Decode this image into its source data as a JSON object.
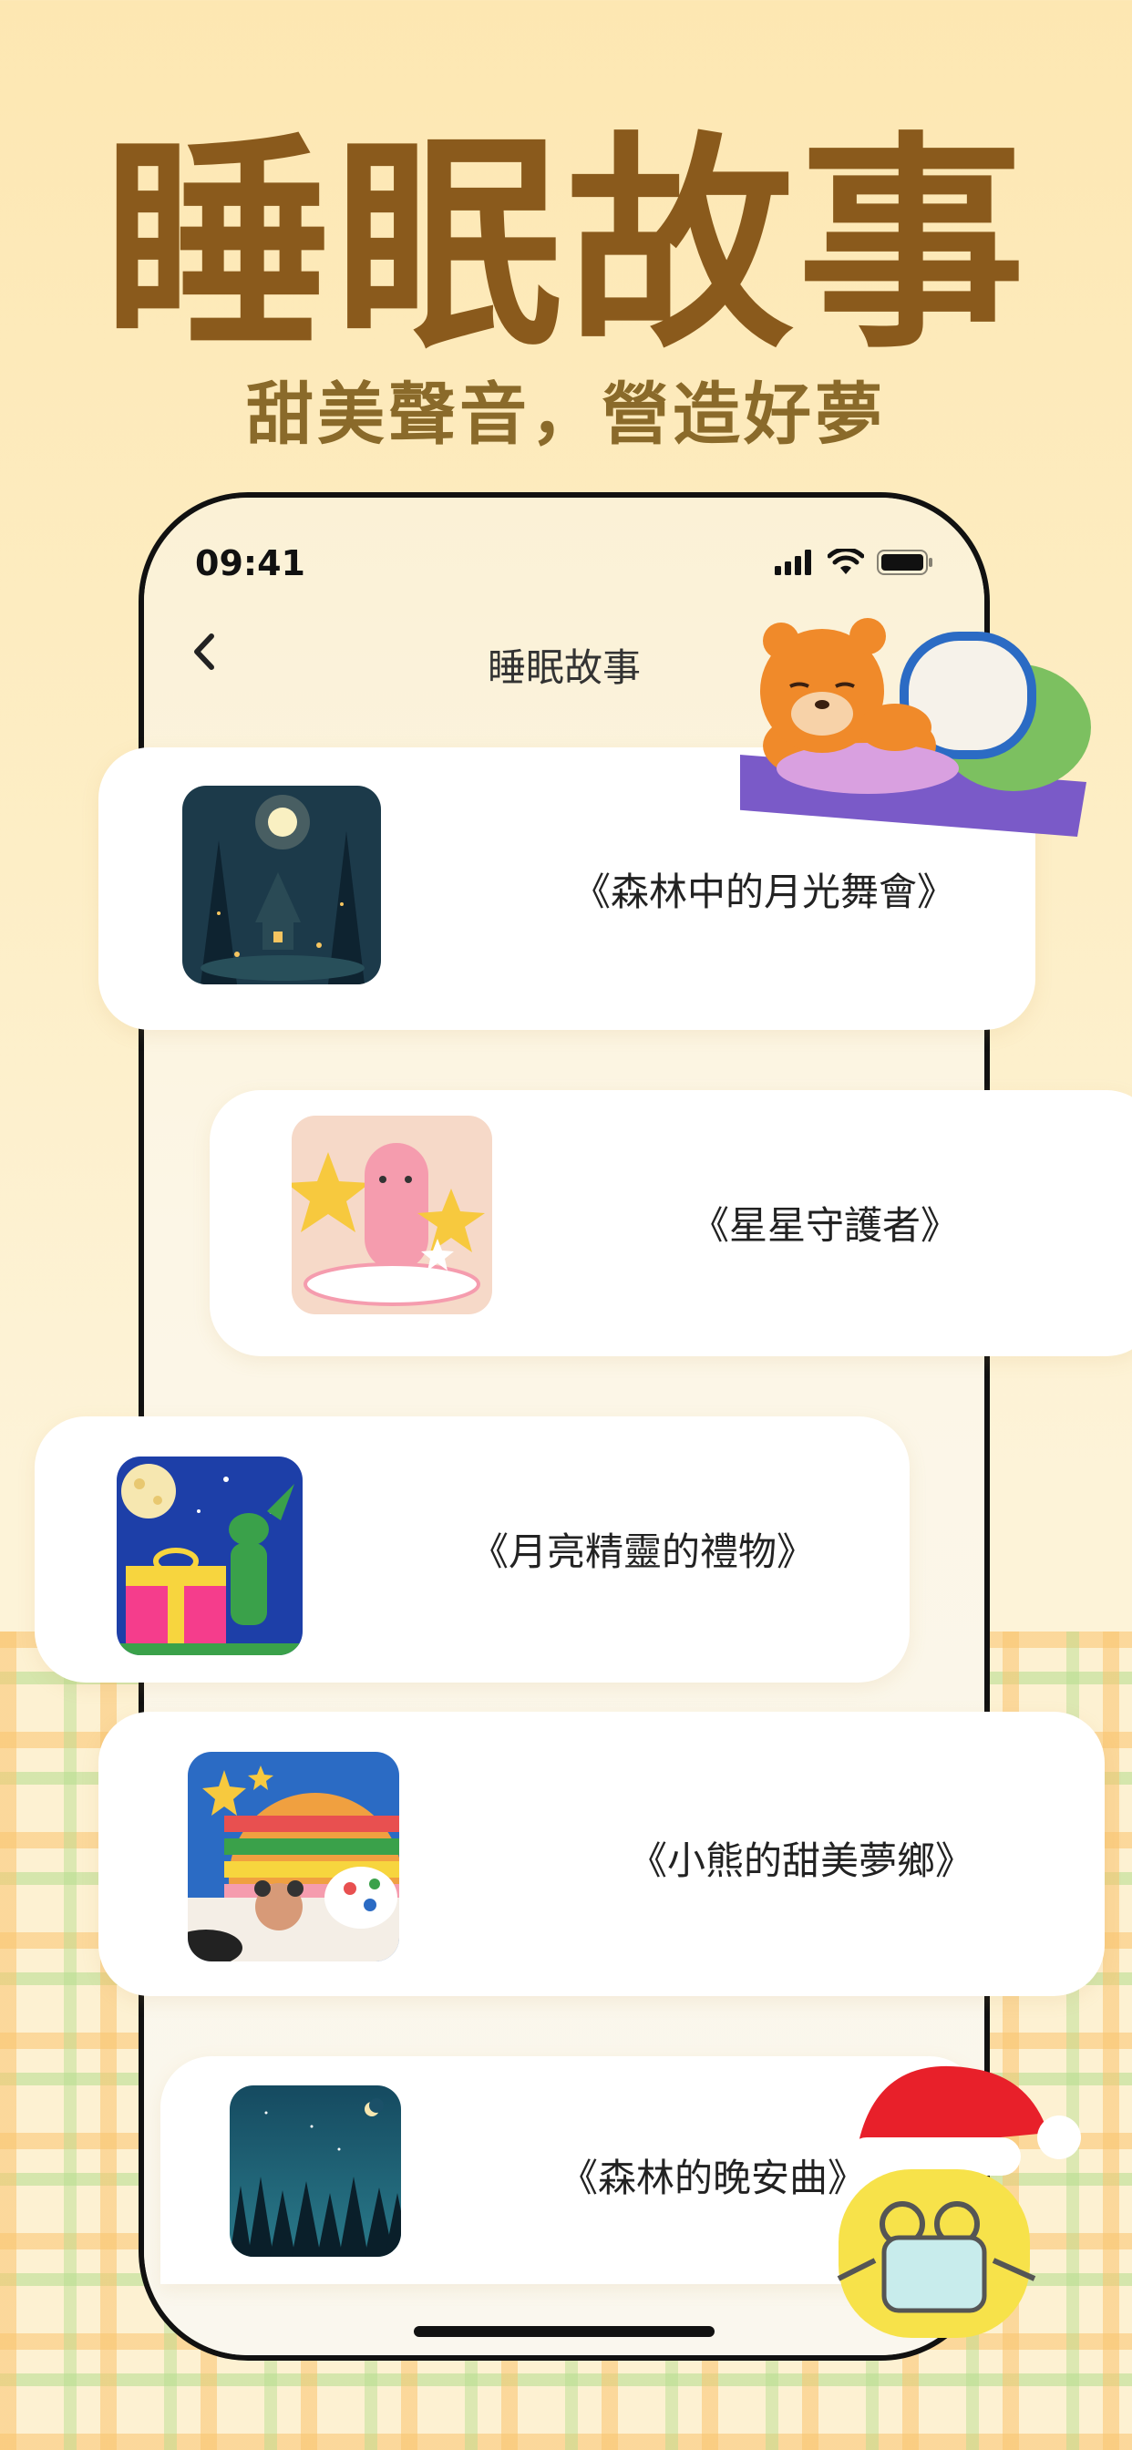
{
  "hero": {
    "title": "睡眠故事",
    "subtitle": "甜美聲音，營造好夢"
  },
  "status_bar": {
    "time": "09:41",
    "icons": [
      "signal-icon",
      "wifi-icon",
      "battery-icon"
    ]
  },
  "nav": {
    "back_icon": "chevron-left-icon",
    "title": "睡眠故事"
  },
  "stories": [
    {
      "title": "《森林中的月光舞會》",
      "thumb": "moonlit-forest-illustration"
    },
    {
      "title": "《星星守護者》",
      "thumb": "pink-creature-stars-illustration"
    },
    {
      "title": "《月亮精靈的禮物》",
      "thumb": "moon-elf-gift-illustration"
    },
    {
      "title": "《小熊的甜美夢鄉》",
      "thumb": "bear-rainbow-blanket-illustration"
    },
    {
      "title": "《森林的晚安曲》",
      "thumb": "night-forest-illustration"
    }
  ],
  "colors": {
    "title": "#8a5a1c",
    "background": "#fde7b2",
    "card": "#ffffff"
  }
}
